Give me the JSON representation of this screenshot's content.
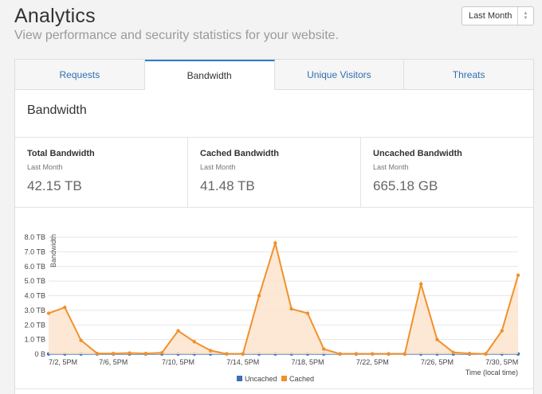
{
  "header": {
    "title": "Analytics",
    "subtitle": "View performance and security statistics for your website.",
    "range_select": "Last Month"
  },
  "tabs": [
    {
      "label": "Requests",
      "active": false
    },
    {
      "label": "Bandwidth",
      "active": true
    },
    {
      "label": "Unique Visitors",
      "active": false
    },
    {
      "label": "Threats",
      "active": false
    }
  ],
  "section": {
    "title": "Bandwidth"
  },
  "stats": [
    {
      "label": "Total Bandwidth",
      "period": "Last Month",
      "value": "42.15 TB"
    },
    {
      "label": "Cached Bandwidth",
      "period": "Last Month",
      "value": "41.48 TB"
    },
    {
      "label": "Uncached Bandwidth",
      "period": "Last Month",
      "value": "665.18 GB"
    }
  ],
  "colors": {
    "cached": "#f0912d",
    "uncached": "#3c6fb5",
    "accent": "#2f7bd1"
  },
  "chart_data": {
    "type": "area",
    "ylabel": "Bandwidth",
    "xlabel": "Time (local time)",
    "ylim": [
      0,
      8
    ],
    "y_ticks": [
      "0 B",
      "1.0 TB",
      "2.0 TB",
      "3.0 TB",
      "4.0 TB",
      "5.0 TB",
      "6.0 TB",
      "7.0 TB",
      "8.0 TB"
    ],
    "x_tick_labels": [
      "7/2, 5PM",
      "7/6, 5PM",
      "7/10, 5PM",
      "7/14, 5PM",
      "7/18, 5PM",
      "7/22, 5PM",
      "7/26, 5PM",
      "7/30, 5PM"
    ],
    "x_tick_index": [
      0,
      4,
      8,
      12,
      16,
      20,
      24,
      28
    ],
    "grid": true,
    "legend_position": "bottom",
    "series": [
      {
        "name": "Uncached",
        "color": "#3c6fb5",
        "values": [
          0.02,
          0.02,
          0.02,
          0.02,
          0.02,
          0.02,
          0.02,
          0.02,
          0.02,
          0.02,
          0.02,
          0.02,
          0.02,
          0.02,
          0.02,
          0.02,
          0.02,
          0.02,
          0.02,
          0.02,
          0.02,
          0.02,
          0.02,
          0.02,
          0.02,
          0.02,
          0.02,
          0.02,
          0.02,
          0.02
        ]
      },
      {
        "name": "Cached",
        "color": "#f0912d",
        "values": [
          2.8,
          3.2,
          0.95,
          0.05,
          0.05,
          0.08,
          0.05,
          0.1,
          1.6,
          0.85,
          0.25,
          0.02,
          0.02,
          4.0,
          7.6,
          3.1,
          2.8,
          0.35,
          0.02,
          0.02,
          0.02,
          0.02,
          0.02,
          4.8,
          1.0,
          0.12,
          0.05,
          0.02,
          1.6,
          5.4
        ]
      }
    ]
  }
}
